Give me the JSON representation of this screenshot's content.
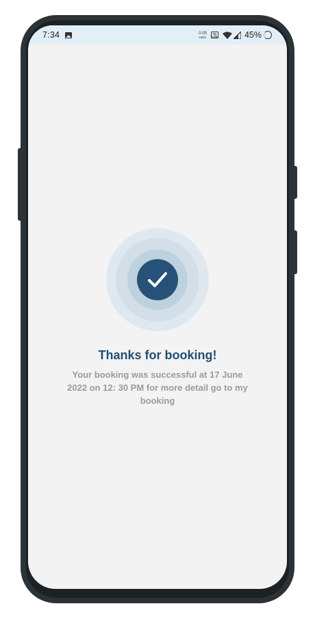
{
  "status_bar": {
    "time": "7:34",
    "net_speed_value": "0.05",
    "net_speed_unit": "KB/S",
    "volte_label": "Vo LTE",
    "battery": "45%"
  },
  "icons": {
    "gallery": "image-icon",
    "wifi": "wifi-icon",
    "signal": "signal-icon",
    "loading": "ring-icon",
    "success": "checkmark-icon"
  },
  "colors": {
    "accent": "#265178",
    "title": "#234f72",
    "message": "#9b9b9b",
    "status_bar_bg": "#e3eff7",
    "screen_bg": "#f3f3f4"
  },
  "confirmation": {
    "title": "Thanks for booking!",
    "message": "Your booking was successful at 17 June 2022 on 12: 30 PM for more detail go to my booking"
  }
}
